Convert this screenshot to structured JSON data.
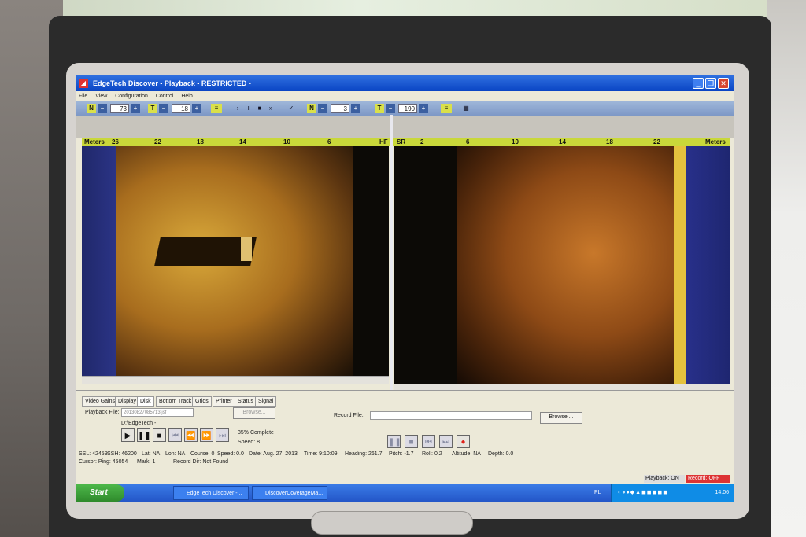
{
  "window": {
    "title": "EdgeTech Discover - Playback   - RESTRICTED -"
  },
  "menu": [
    "File",
    "View",
    "Configuration",
    "Control",
    "Help"
  ],
  "toolbar": {
    "n_label": "N",
    "minus": "−",
    "plus": "+",
    "left_gain": "73",
    "t_label": "T",
    "left_t": "18",
    "right_gain": "3",
    "right_t": "190",
    "icons": [
      "play-icon",
      "pause-icon",
      "stop-icon",
      "fast-forward-icon",
      "check-icon",
      "grid-icon"
    ]
  },
  "ruler": {
    "left_unit": "Meters",
    "left_ticks": [
      "26",
      "22",
      "18",
      "14",
      "10",
      "6"
    ],
    "left_end": "HF",
    "right_start": "SR",
    "right_ticks": [
      "2",
      "6",
      "10",
      "14",
      "18",
      "22"
    ],
    "right_unit": "Meters"
  },
  "tabs": [
    "Video Gains",
    "Display",
    "Disk",
    "Bottom Track",
    "Grids",
    "Printer",
    "Status",
    "Signal"
  ],
  "panel": {
    "playback_file_label": "Playback File:",
    "playback_file_value": "20130827085713.jsf",
    "browse_disabled": "Browse...",
    "dir_text": "D:\\EdgeTech -",
    "record_file_label": "Record File:",
    "browse_label": "Browse ...",
    "percent_complete": "35% Complete",
    "speed": "Speed: 8"
  },
  "status": {
    "ssl": "SSL: 42459",
    "ssh": "SSH: 46200",
    "lat": "Lat: NA",
    "lon": "Lon: NA",
    "course": "Course: 0",
    "speed_line": "Speed: 0.0",
    "date": "Date: Aug. 27, 2013",
    "time": "Time: 9:10:09",
    "heading": "Heading: 261.7",
    "pitch": "Pitch: -1.7",
    "roll": "Roll: 0.2",
    "altitude": "Altitude: NA",
    "depth": "Depth: 0.0",
    "cursor_ping": "Cursor: Ping: 45054",
    "mark": "Mark: 1",
    "record_dir": "Record Dir: Not Found"
  },
  "taskbar": {
    "start": "Start",
    "task1": "EdgeTech Discover -...",
    "task2": "DiscoverCoverageMa...",
    "lang": "PL",
    "clock": "14:06"
  },
  "indicators": {
    "playback": "Playback: ON",
    "record": "Record: OFF"
  }
}
